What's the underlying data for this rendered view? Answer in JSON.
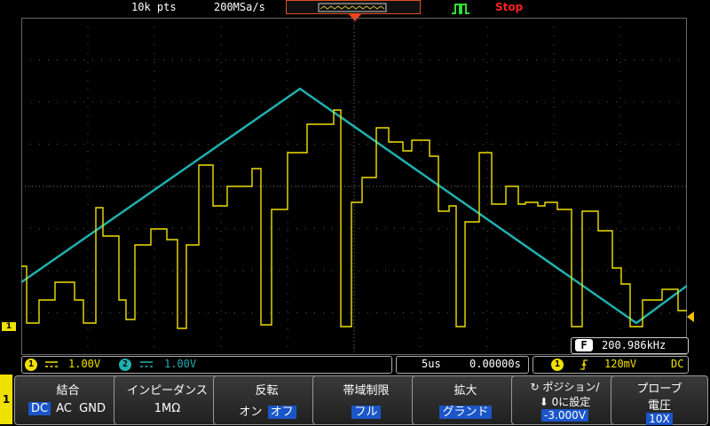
{
  "top": {
    "points": "10k pts",
    "sample_rate": "200MSa/s",
    "run_status": "Stop"
  },
  "colors": {
    "ch1": "#f0e000",
    "ch2": "#20b0b0",
    "accent": "#1a56c8",
    "stop": "#ff2020"
  },
  "status": {
    "ch1_badge": "1",
    "ch1_coupling_icon": "dc-coupling-icon",
    "ch1_scale": "1.00V",
    "ch2_badge": "2",
    "ch2_scale": "1.00V",
    "timebase": "5us",
    "position": "0.00000s",
    "trig_badge": "1",
    "trig_level": "120mV",
    "trig_coupling": "DC",
    "frequency_icon": "F",
    "frequency": "200.986kHz"
  },
  "channel_marker": "1",
  "menu": {
    "side_label": "1",
    "buttons": [
      {
        "title": "結合",
        "options": [
          "DC",
          "AC",
          "GND"
        ],
        "selected": "DC"
      },
      {
        "title": "インピーダンス",
        "value": "1MΩ"
      },
      {
        "title": "反転",
        "options": [
          "オン",
          "オフ"
        ],
        "selected": "オフ"
      },
      {
        "title": "帯域制限",
        "value": "フル"
      },
      {
        "title": "拡大",
        "value": "グランド"
      },
      {
        "title": "ポジション/",
        "title2": "0に設定",
        "value": "-3.000V"
      },
      {
        "title": "プローブ",
        "title2": "電圧",
        "value": "10X"
      }
    ]
  }
}
